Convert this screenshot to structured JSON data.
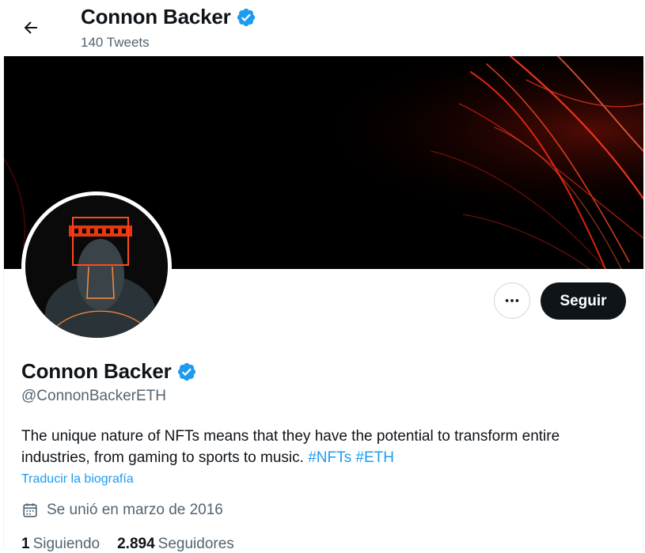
{
  "header": {
    "name": "Connon Backer",
    "tweet_count": "140 Tweets"
  },
  "icons": {
    "back": "arrow-left-icon",
    "verified": "verified-badge-icon",
    "more": "more-horizontal-icon",
    "calendar": "calendar-icon"
  },
  "actions": {
    "follow_label": "Seguir"
  },
  "profile": {
    "name": "Connon Backer",
    "handle": "@ConnonBackerETH",
    "bio_text": "The unique nature of NFTs means that they have the potential to transform entire industries, from gaming to sports to music.",
    "hashtags": [
      "#NFTs",
      "#ETH"
    ],
    "translate_label": "Traducir la biografía",
    "joined": "Se unió en marzo de 2016",
    "following_count": "1",
    "following_label": "Siguiendo",
    "followers_count": "2.894",
    "followers_label": "Seguidores"
  },
  "colors": {
    "accent": "#1d9bf0",
    "text_primary": "#0f1419",
    "text_secondary": "#536471",
    "banner_glow": "#ff3b1f"
  }
}
